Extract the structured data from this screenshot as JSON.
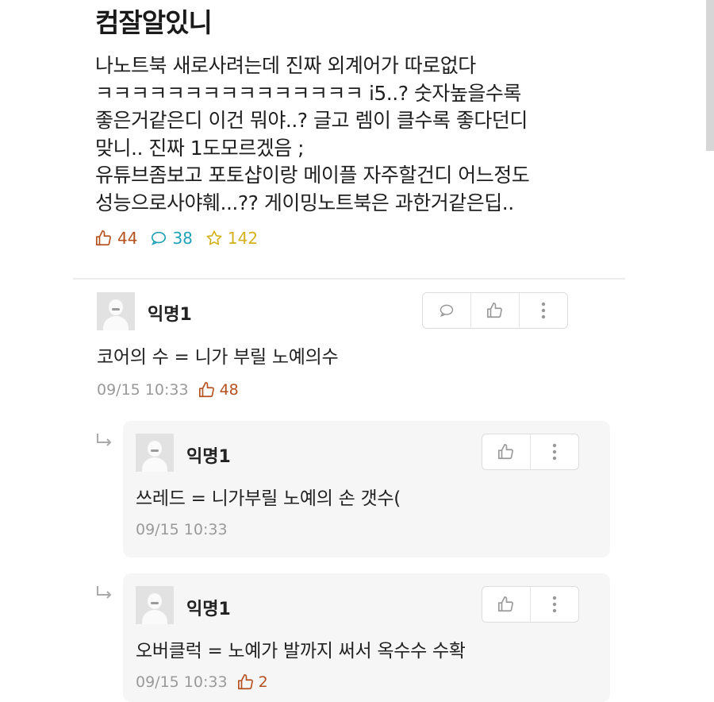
{
  "post": {
    "title": "컴잘알있니",
    "body_lines": [
      "나노트북 새로사려는데 진짜 외계어가 따로없다",
      "ㅋㅋㅋㅋㅋㅋㅋㅋㅋㅋㅋㅋㅋㅋㅋ i5..? 숫자높을수록",
      "좋은거같은디 이건 뭐야..? 글고 렘이 클수록 좋다던디",
      "맞니.. 진짜 1도모르겠음 ;",
      "유튜브좀보고 포토샵이랑 메이플 자주할건디 어느정도",
      "성능으로사야훼...?? 게이밍노트북은 과한거같은딥.."
    ],
    "likes": "44",
    "comments": "38",
    "scraps": "142"
  },
  "comments": [
    {
      "author": "익명1",
      "text": "코어의 수 = 니가 부릴 노예의수",
      "time": "09/15 10:33",
      "likes": "48"
    }
  ],
  "replies": [
    {
      "author": "익명1",
      "text": "쓰레드 = 니가부릴 노예의 손 갯수(",
      "time": "09/15 10:33"
    },
    {
      "author": "익명1",
      "text": "오버클럭 = 노예가 발까지 써서 옥수수 수확",
      "time": "09/15 10:33",
      "likes": "2"
    }
  ],
  "colors": {
    "like": "#b5501f",
    "comment": "#22a2b8",
    "scrap": "#d4b21e",
    "meta": "#9a9a9a"
  },
  "icons": [
    "thumbs-up-icon",
    "speech-bubble-icon",
    "star-icon",
    "more-vertical-icon",
    "reply-arrow-icon",
    "avatar-icon"
  ]
}
